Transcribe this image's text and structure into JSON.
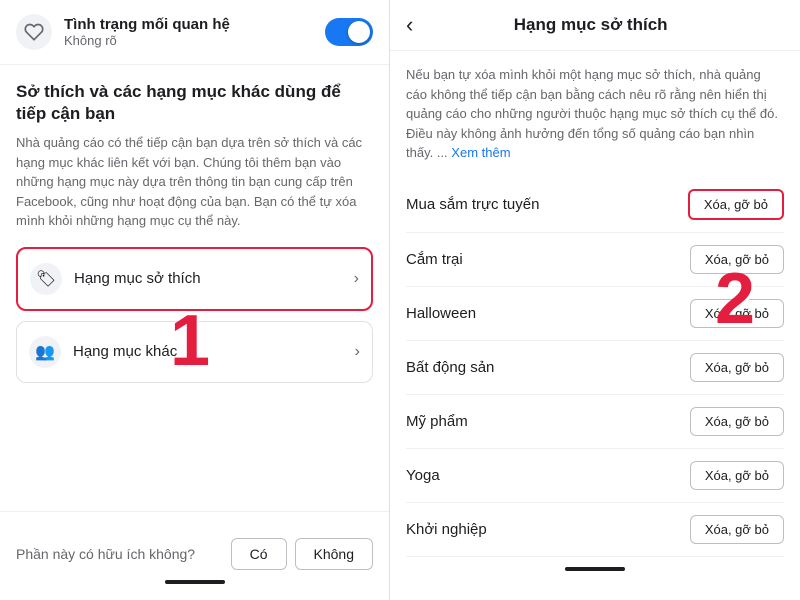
{
  "left": {
    "relationship": {
      "title": "Tình trạng mối quan hệ",
      "subtitle": "Không rõ",
      "toggle_on": true
    },
    "section_title": "Sở thích và các hạng mục khác dùng để tiếp cận bạn",
    "section_desc": "Nhà quảng cáo có thể tiếp cận bạn dựa trên sở thích và các hạng mục khác liên kết với bạn. Chúng tôi thêm bạn vào những hạng mục này dựa trên thông tin bạn cung cấp trên Facebook, cũng như hoạt động của bạn. Bạn có thể tự xóa mình khỏi những hạng mục cụ thể này.",
    "menu_items": [
      {
        "id": "hang-muc-so-thich",
        "icon": "🏷",
        "label": "Hạng mục sở thích",
        "highlighted": true
      },
      {
        "id": "hang-muc-khac",
        "icon": "👥",
        "label": "Hạng mục khác",
        "highlighted": false
      }
    ],
    "feedback": {
      "question": "Phần này có hữu ích không?",
      "yes": "Có",
      "no": "Không"
    }
  },
  "right": {
    "back_label": "‹",
    "title": "Hạng mục sở thích",
    "description": "Nếu bạn tự xóa mình khỏi một hạng mục sở thích, nhà quảng cáo không thể tiếp cận bạn bằng cách nêu rõ rằng nên hiển thị quảng cáo cho những người thuộc hạng mục sở thích cụ thể đó. Điều này không ảnh hưởng đến tổng số quảng cáo bạn nhìn thấy. ...",
    "see_more": "Xem thêm",
    "interests": [
      {
        "name": "Mua sắm trực tuyến",
        "highlighted": true,
        "btn": "Xóa, gỡ bỏ"
      },
      {
        "name": "Cắm trại",
        "highlighted": false,
        "btn": "Xóa, gỡ bỏ"
      },
      {
        "name": "Halloween",
        "highlighted": false,
        "btn": "Xóa, gỡ bỏ"
      },
      {
        "name": "Bất động sản",
        "highlighted": false,
        "btn": "Xóa, gỡ bỏ"
      },
      {
        "name": "Mỹ phẩm",
        "highlighted": false,
        "btn": "Xóa, gỡ bỏ"
      },
      {
        "name": "Yoga",
        "highlighted": false,
        "btn": "Xóa, gỡ bỏ"
      },
      {
        "name": "Khởi nghiệp",
        "highlighted": false,
        "btn": "Xóa, gỡ bỏ"
      }
    ]
  },
  "badge1": "1",
  "badge2": "2"
}
